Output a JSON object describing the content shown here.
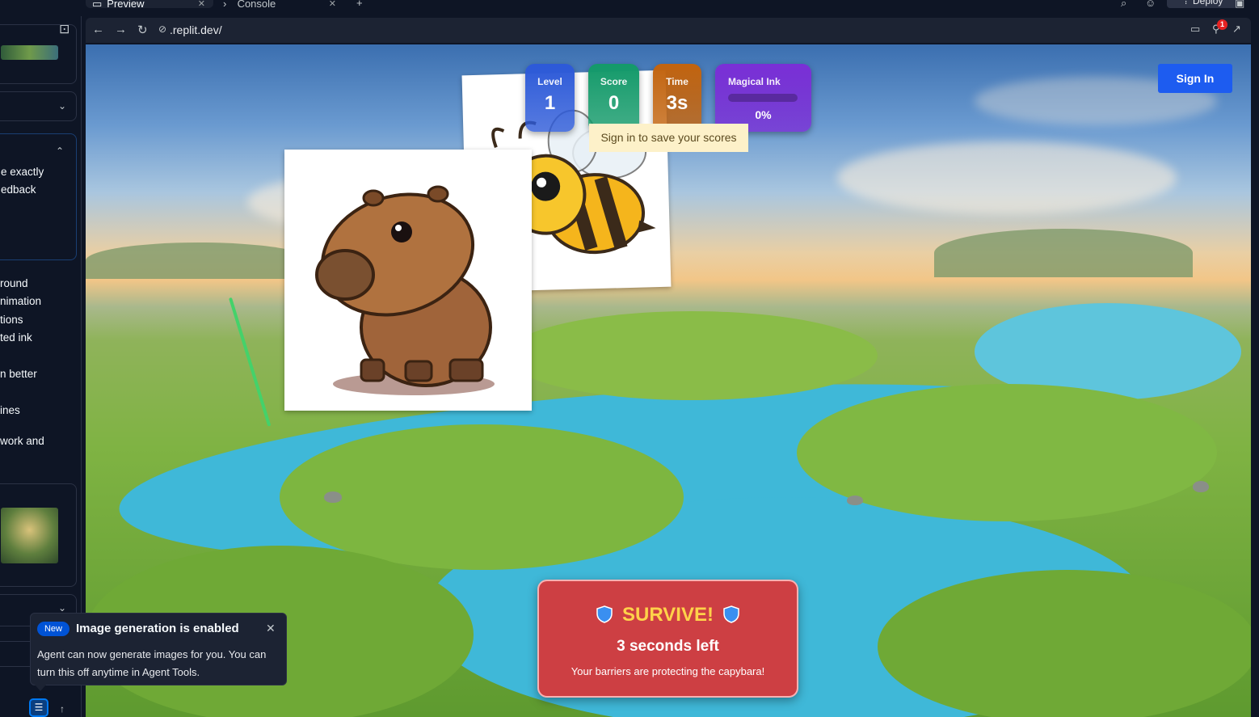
{
  "tabs": [
    {
      "label": "Preview",
      "active": true
    },
    {
      "label": "Console",
      "active": false
    }
  ],
  "header": {
    "deploy_label": "Deploy"
  },
  "sidebar": {
    "lines_a": [
      "e exactly",
      "edback"
    ],
    "lines_b": [
      "round",
      "nimation",
      "tions",
      "ted ink",
      "n better",
      "ines",
      "work and"
    ]
  },
  "browser": {
    "url": ".replit.dev/",
    "notification_count": "1"
  },
  "game": {
    "stats": {
      "level": {
        "label": "Level",
        "value": "1",
        "color": "#2d5ad8"
      },
      "score": {
        "label": "Score",
        "value": "0",
        "color": "#149a6a"
      },
      "time": {
        "label": "Time",
        "value": "3s",
        "color": "#c2640f"
      },
      "ink": {
        "label": "Magical Ink",
        "value": "0%",
        "progress": 0,
        "color": "#7a2fd6"
      }
    },
    "tooltip": "Sign in to save your scores",
    "sign_in_label": "Sign In",
    "banner": {
      "title": "SURVIVE!",
      "subtitle": "3 seconds left",
      "note": "Your barriers are protecting the capybara!"
    }
  },
  "toast": {
    "badge": "New",
    "title": "Image generation is enabled",
    "body": "Agent can now generate images for you. You can turn this off anytime in Agent Tools."
  },
  "icons": [
    "preview-icon",
    "console-icon",
    "close-icon",
    "plus-icon",
    "search-icon",
    "user-icon",
    "rocket-icon",
    "layout-icon",
    "new-chat-icon",
    "chevron-down-icon",
    "chevron-up-icon",
    "back-arrow-icon",
    "forward-arrow-icon",
    "reload-icon",
    "link-icon",
    "devices-icon",
    "tools-icon",
    "external-link-icon",
    "shield-icon",
    "sliders-icon",
    "arrow-up-icon"
  ]
}
